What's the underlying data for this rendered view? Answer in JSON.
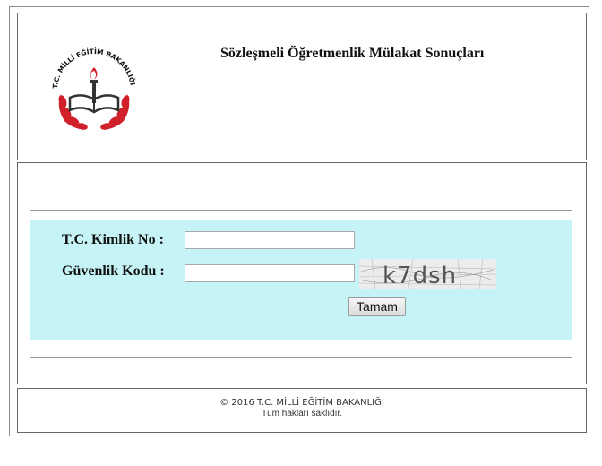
{
  "header": {
    "logo_text": "T.C. MİLLİ EĞİTİM BAKANLIĞI",
    "title": "Sözleşmeli Öğretmenlik Mülakat Sonuçları"
  },
  "form": {
    "tc_label": "T.C. Kimlik No :",
    "tc_value": "",
    "security_label": "Güvenlik Kodu :",
    "security_value": "",
    "captcha_text": "k7dsh",
    "submit_label": "Tamam"
  },
  "footer": {
    "copyright": "© 2016 T.C. MİLLİ EĞİTİM BAKANLIĞI",
    "rights": "Tüm hakları saklıdır."
  },
  "colors": {
    "form_bg": "#c6f3f5",
    "logo_red": "#d0202a"
  }
}
